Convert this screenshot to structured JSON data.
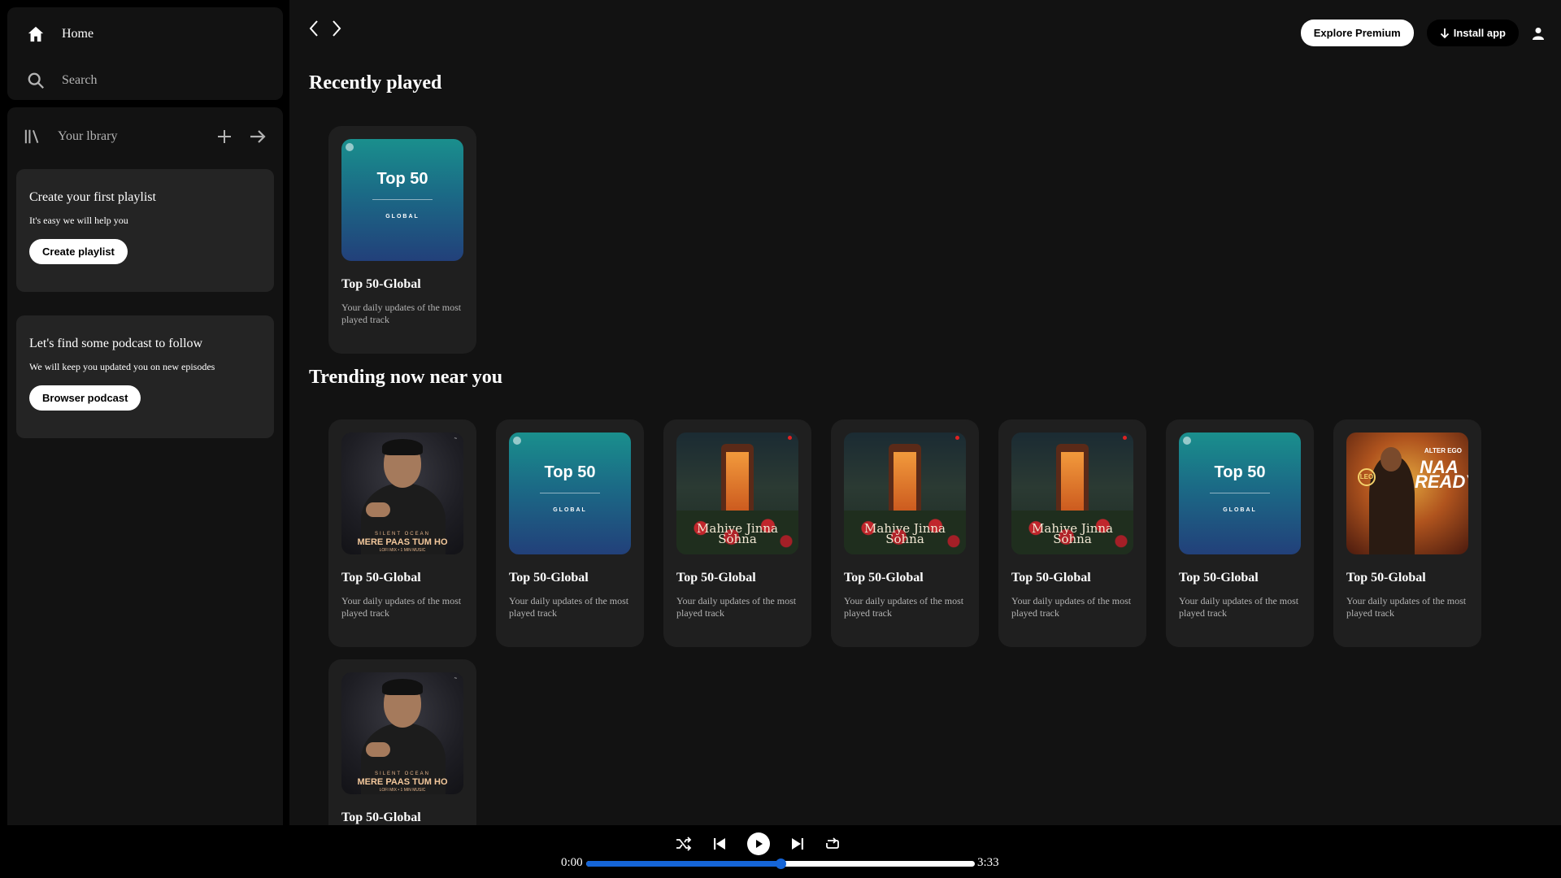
{
  "nav": {
    "home": "Home",
    "search": "Search"
  },
  "library": {
    "label": "Your lbrary"
  },
  "promo_playlist": {
    "title": "Create your first playlist",
    "subtitle": "It's easy we will help you",
    "button": "Create playlist"
  },
  "promo_podcast": {
    "title": "Let's find some podcast to follow",
    "subtitle": "We will keep you updated you on new episodes",
    "button": "Browser podcast"
  },
  "header": {
    "premium": "Explore Premium",
    "install": "Install app"
  },
  "sections": {
    "recent": "Recently played",
    "trending": "Trending now near you"
  },
  "artwork": {
    "top50_main": "Top 50",
    "top50_sub": "GLOBAL",
    "rahat_small": "SILENT OCEAN",
    "rahat_big": "MERE PAAS TUM HO",
    "rahat_tiny": "LOFI MIX • 1 MIN MUSIC",
    "mahiye_title": "Mahiye Jinna Sohna",
    "leo_top": "ALTER EGO",
    "leo_big": "NAA READY",
    "leo_badge": "LEO"
  },
  "recent_cards": [
    {
      "title": "Top 50-Global",
      "subtitle": "Your daily updates of the most played track",
      "art": "top50"
    }
  ],
  "trending_cards": [
    {
      "title": "Top 50-Global",
      "subtitle": "Your daily updates of the most played track",
      "art": "rahat"
    },
    {
      "title": "Top 50-Global",
      "subtitle": "Your daily updates of the most played track",
      "art": "top50"
    },
    {
      "title": "Top 50-Global",
      "subtitle": "Your daily updates of the most played track",
      "art": "mahiye"
    },
    {
      "title": "Top 50-Global",
      "subtitle": "Your daily updates of the most played track",
      "art": "mahiye"
    },
    {
      "title": "Top 50-Global",
      "subtitle": "Your daily updates of the most played track",
      "art": "mahiye"
    },
    {
      "title": "Top 50-Global",
      "subtitle": "Your daily updates of the most played track",
      "art": "top50"
    },
    {
      "title": "Top 50-Global",
      "subtitle": "Your daily updates of the most played track",
      "art": "leo"
    },
    {
      "title": "Top 50-Global",
      "subtitle": "",
      "art": "rahat"
    }
  ],
  "player": {
    "current_time": "0:00",
    "total_time": "3:33",
    "progress_fraction": 0.5
  },
  "icons": {
    "home": "home-icon",
    "search": "search-icon",
    "library": "library-icon",
    "add": "plus-icon",
    "expand": "arrow-right-icon",
    "back": "chevron-left-icon",
    "forward": "chevron-right-icon",
    "download": "download-icon",
    "user": "user-icon",
    "shuffle": "shuffle-icon",
    "previous": "skip-back-icon",
    "play": "play-icon",
    "next": "skip-forward-icon",
    "repeat": "repeat-icon"
  },
  "colors": {
    "background": "#000000",
    "panel": "#121212",
    "card": "#1f1f1f",
    "promo": "#242424",
    "progress_fill": "#1565d8"
  }
}
